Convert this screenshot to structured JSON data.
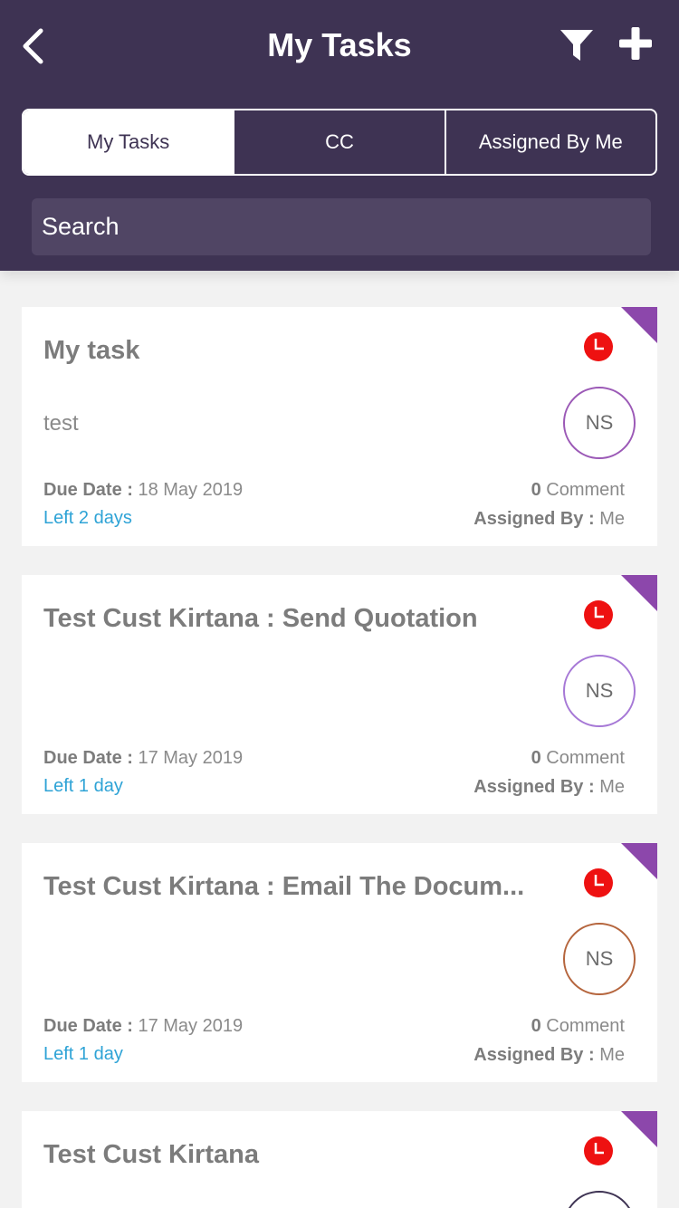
{
  "header": {
    "title": "My Tasks",
    "back_icon": "chevron-left-icon",
    "filter_icon": "filter-icon",
    "add_icon": "plus-icon",
    "background": "#3e3353"
  },
  "tabs": [
    {
      "label": "My Tasks",
      "active": true
    },
    {
      "label": "CC",
      "active": false
    },
    {
      "label": "Assigned By Me",
      "active": false
    }
  ],
  "search": {
    "placeholder": "Search",
    "value": ""
  },
  "tasks": [
    {
      "title": "My task",
      "description": "test",
      "avatar_initials": "NS",
      "avatar_color": "#9b59b6",
      "due_label": "Due Date :",
      "due_date": "18 May 2019",
      "time_left": "Left 2 days",
      "comment_count": "0",
      "comment_label": "Comment",
      "assigned_label": "Assigned By :",
      "assigned_by": "Me"
    },
    {
      "title": "Test Cust Kirtana : Send Quotation",
      "description": "",
      "avatar_initials": "NS",
      "avatar_color": "#a678d6",
      "due_label": "Due Date :",
      "due_date": "17 May 2019",
      "time_left": "Left 1 day",
      "comment_count": "0",
      "comment_label": "Comment",
      "assigned_label": "Assigned By :",
      "assigned_by": "Me"
    },
    {
      "title": "Test Cust Kirtana : Email The Docum...",
      "description": "",
      "avatar_initials": "NS",
      "avatar_color": "#b5653d",
      "due_label": "Due Date :",
      "due_date": "17 May 2019",
      "time_left": "Left 1 day",
      "comment_count": "0",
      "comment_label": "Comment",
      "assigned_label": "Assigned By :",
      "assigned_by": "Me"
    },
    {
      "title": "Test Cust Kirtana",
      "description": "",
      "avatar_initials": "",
      "avatar_color": "#3e3353"
    }
  ],
  "colors": {
    "status_clock": "#ee1111",
    "corner_flag": "#8c47ab",
    "link": "#2ea3d6"
  }
}
